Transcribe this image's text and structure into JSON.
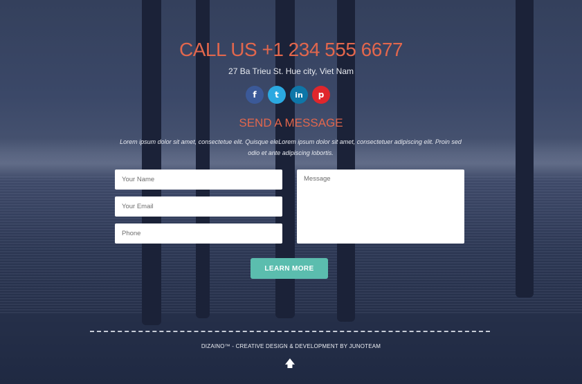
{
  "contact": {
    "call_text": "CALL US +1 234 555 6677",
    "address": "27 Ba Trieu St. Hue city, Viet Nam"
  },
  "social": [
    {
      "glyph": "f",
      "icon": "facebook-icon",
      "color": "#3b5998"
    },
    {
      "glyph": "t",
      "icon": "twitter-icon",
      "color": "#2ba9e1"
    },
    {
      "glyph": "in",
      "icon": "linkedin-icon",
      "color": "#0e76a8"
    },
    {
      "glyph": "p",
      "icon": "pinterest-icon",
      "color": "#e0262c"
    }
  ],
  "message_section": {
    "heading": "SEND A MESSAGE",
    "intro": "Lorem ipsum dolor sit amet, consectetue elit. Quisque eleLorem ipsum dolor sit amet, consectetuer adipiscing elit. Proin sed odio et ante adipiscing lobortis."
  },
  "form": {
    "name_placeholder": "Your Name",
    "email_placeholder": "Your Email",
    "phone_placeholder": "Phone",
    "message_placeholder": "Message",
    "submit_label": "LEARN MORE"
  },
  "footer": {
    "text": "DIZAINO™ - CREATIVE DESIGN & DEVELOPMENT BY JUNOTEAM",
    "scroll_top_icon": "up-arrow-icon"
  },
  "colors": {
    "accent": "#e2674d",
    "button": "#5bbdae",
    "background": "#1f2942"
  }
}
